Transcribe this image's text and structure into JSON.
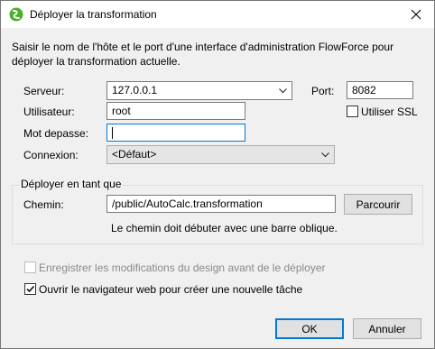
{
  "window": {
    "title": "Déployer la transformation",
    "close_symbol": "✕"
  },
  "description": "Saisir le nom de l'hôte et le port d'une interface d'administration FlowForce pour déployer la transformation actuelle.",
  "server": {
    "label": "Serveur:",
    "value": "127.0.0.1",
    "port_label": "Port:",
    "port_value": "8082"
  },
  "user": {
    "label": "Utilisateur:",
    "value": "root",
    "ssl_label": "Utiliser SSL",
    "ssl_checked": false
  },
  "password": {
    "label": "Mot depasse:",
    "value": ""
  },
  "connection": {
    "label": "Connexion:",
    "value": "<Défaut>"
  },
  "deploy_group": {
    "title": "Déployer en tant que",
    "path_label": "Chemin:",
    "path_value": "/public/AutoCalc.transformation",
    "browse_label": "Parcourir",
    "hint": "Le chemin doit débuter avec une barre oblique."
  },
  "options": {
    "save_design_label": "Enregistrer les modifications du design avant de le déployer",
    "save_design_checked": false,
    "save_design_enabled": false,
    "open_browser_label": "Ouvrir le navigateur web pour créer une nouvelle tâche",
    "open_browser_checked": true
  },
  "buttons": {
    "ok": "OK",
    "cancel": "Annuler"
  },
  "icons": {
    "app_icon": "flowforce-app-icon",
    "close": "close-icon",
    "dropdown": "chevron-down-icon",
    "check": "checkmark-icon"
  },
  "colors": {
    "accent": "#0078d7",
    "app_icon_green": "#4caf2a"
  }
}
